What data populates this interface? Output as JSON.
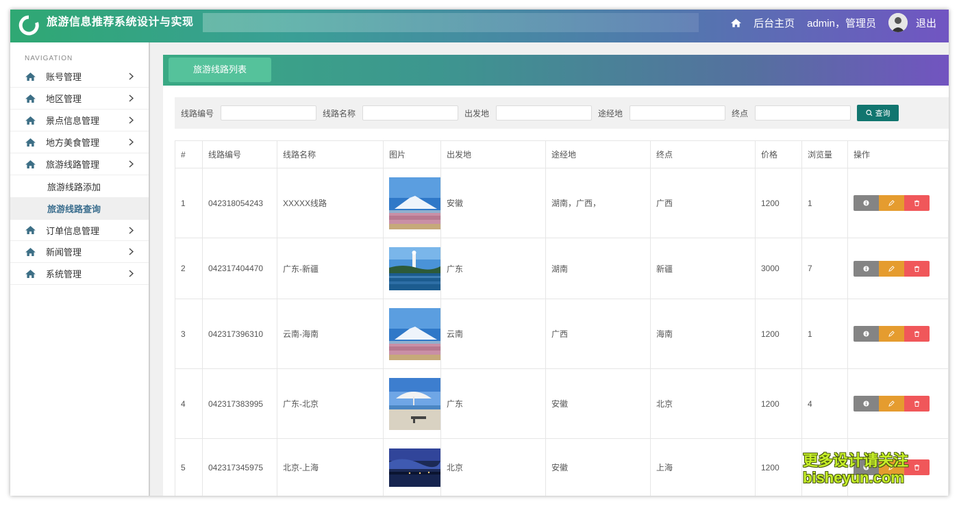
{
  "header": {
    "title": "旅游信息推荐系统设计与实现",
    "home_link": "后台主页",
    "user": "admin，管理员",
    "logout": "退出"
  },
  "sidebar": {
    "heading": "NAVIGATION",
    "items": [
      {
        "label": "账号管理"
      },
      {
        "label": "地区管理"
      },
      {
        "label": "景点信息管理"
      },
      {
        "label": "地方美食管理"
      },
      {
        "label": "旅游线路管理"
      }
    ],
    "sub_items": [
      {
        "label": "旅游线路添加"
      },
      {
        "label": "旅游线路查询"
      }
    ],
    "items_after": [
      {
        "label": "订单信息管理"
      },
      {
        "label": "新闻管理"
      },
      {
        "label": "系统管理"
      }
    ]
  },
  "tab": {
    "label": "旅游线路列表"
  },
  "search": {
    "labels": [
      "线路编号",
      "线路名称",
      "出发地",
      "途经地",
      "终点"
    ],
    "button": "查询"
  },
  "table": {
    "headers": [
      "#",
      "线路编号",
      "线路名称",
      "图片",
      "出发地",
      "途经地",
      "终点",
      "价格",
      "浏览量",
      "操作"
    ],
    "rows": [
      {
        "idx": "1",
        "code": "042318054243",
        "name": "XXXXX线路",
        "image": "snow-mountain-cherry",
        "from": "安徽",
        "via": "湖南，广西，",
        "to": "广西",
        "price": "1200",
        "views": "1"
      },
      {
        "idx": "2",
        "code": "042317404470",
        "name": "广东-新疆",
        "image": "statue-coast",
        "from": "广东",
        "via": "湖南",
        "to": "新疆",
        "price": "3000",
        "views": "7"
      },
      {
        "idx": "3",
        "code": "042317396310",
        "name": "云南-海南",
        "image": "snow-mountain-cherry",
        "from": "云南",
        "via": "广西",
        "to": "海南",
        "price": "1200",
        "views": "1"
      },
      {
        "idx": "4",
        "code": "042317383995",
        "name": "广东-北京",
        "image": "beach-umbrella",
        "from": "广东",
        "via": "安徽",
        "to": "北京",
        "price": "1200",
        "views": "4"
      },
      {
        "idx": "5",
        "code": "042317345975",
        "name": "北京-上海",
        "image": "night-lake",
        "from": "北京",
        "via": "安徽",
        "to": "上海",
        "price": "1200",
        "views": ""
      }
    ]
  },
  "watermark": {
    "line1": "更多设计请关注",
    "line2": "bisheyun.com"
  },
  "colors": {
    "accent_green": "#2fa873",
    "accent_purple": "#7155c2",
    "query_button": "#11756f",
    "view": "#848484",
    "edit": "#e59c2f",
    "delete": "#f0575a"
  }
}
